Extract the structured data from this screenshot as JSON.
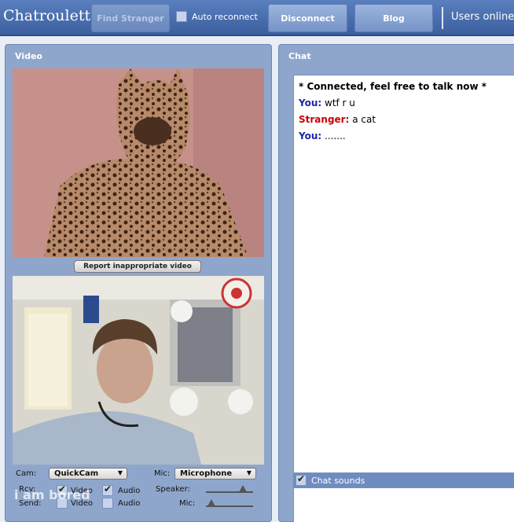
{
  "app": {
    "title": "Chatroulette",
    "users_online_label": "Users online"
  },
  "topbar": {
    "find_stranger": "Find Stranger",
    "auto_reconnect": "Auto reconnect",
    "auto_reconnect_checked": false,
    "disconnect": "Disconnect",
    "blog": "Blog"
  },
  "video": {
    "title": "Video",
    "report_button": "Report inappropriate video",
    "controls": {
      "cam_label": "Cam:",
      "cam_value": "QuickCam",
      "mic_label": "Mic:",
      "mic_value": "Microphone",
      "rcv_label": "Rcv:",
      "send_label": "Send:",
      "video_label": "Video",
      "audio_label": "Audio",
      "rcv_video": true,
      "rcv_audio": true,
      "send_video": false,
      "send_audio": false,
      "speaker_label": "Speaker:",
      "mic_level_label": "Mic:",
      "speaker_level": 0.78,
      "mic_level": 0.12
    }
  },
  "chat": {
    "title": "Chat",
    "messages": [
      {
        "type": "system",
        "text": "* Connected, feel free to talk now *"
      },
      {
        "type": "you",
        "sender": "You:",
        "text": " wtf r u"
      },
      {
        "type": "stranger",
        "sender": "Stranger:",
        "text": " a cat"
      },
      {
        "type": "you",
        "sender": "You:",
        "text": " ......."
      }
    ],
    "chat_sounds_label": "Chat sounds",
    "chat_sounds_checked": true
  },
  "watermark": "i am bored",
  "colors": {
    "header": "#3b5f9f",
    "panel": "#8fa6cc",
    "you": "#1a26a6",
    "stranger": "#cc0000"
  }
}
